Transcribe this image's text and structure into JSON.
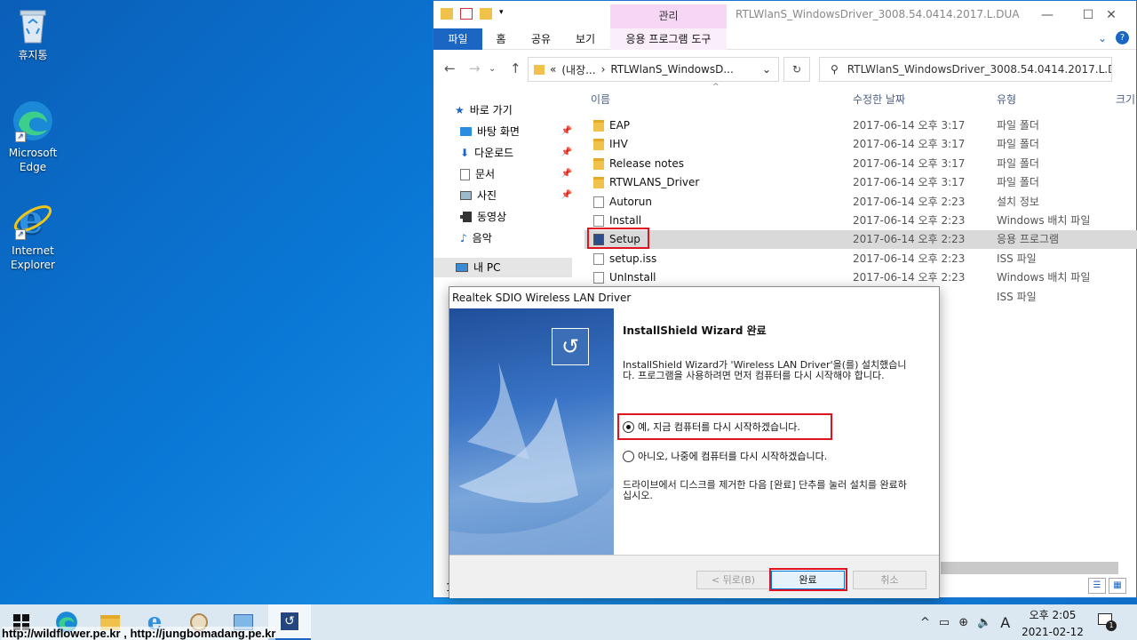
{
  "desktop": {
    "icons": [
      {
        "label": "휴지통"
      },
      {
        "label": "Microsoft Edge"
      },
      {
        "label": "Internet Explorer"
      }
    ]
  },
  "explorer": {
    "title": "RTLWlanS_WindowsDriver_3008.54.0414.2017.L.DUA",
    "manage_tab": "관리",
    "ribbon_tabs": [
      "파일",
      "홈",
      "공유",
      "보기",
      "응용 프로그램 도구"
    ],
    "address": {
      "prefix": "«",
      "crumb1": "(내장...",
      "sep": "›",
      "crumb2": "RTLWlanS_WindowsD..."
    },
    "search_placeholder": "RTLWlanS_WindowsDriver_3008.54.0414.2017.L.DUA ...",
    "nav": {
      "quick_access": "바로 가기",
      "desktop": "바탕 화면",
      "downloads": "다운로드",
      "documents": "문서",
      "pictures": "사진",
      "videos": "동영상",
      "music": "음악",
      "this_pc": "내 PC"
    },
    "columns": {
      "name": "이름",
      "modified": "수정한 날짜",
      "type": "유형",
      "size": "크기"
    },
    "files": [
      {
        "name": "EAP",
        "date": "2017-06-14 오후 3:17",
        "type": "파일 폴더",
        "kind": "folder"
      },
      {
        "name": "IHV",
        "date": "2017-06-14 오후 3:17",
        "type": "파일 폴더",
        "kind": "folder"
      },
      {
        "name": "Release notes",
        "date": "2017-06-14 오후 3:17",
        "type": "파일 폴더",
        "kind": "folder"
      },
      {
        "name": "RTWLANS_Driver",
        "date": "2017-06-14 오후 3:17",
        "type": "파일 폴더",
        "kind": "folder"
      },
      {
        "name": "Autorun",
        "date": "2017-06-14 오후 2:23",
        "type": "설치 정보",
        "kind": "doc"
      },
      {
        "name": "Install",
        "date": "2017-06-14 오후 2:23",
        "type": "Windows 배치 파일",
        "kind": "doc"
      },
      {
        "name": "Setup",
        "date": "2017-06-14 오후 2:23",
        "type": "응용 프로그램",
        "kind": "app"
      },
      {
        "name": "setup.iss",
        "date": "2017-06-14 오후 2:23",
        "type": "ISS 파일",
        "kind": "doc"
      },
      {
        "name": "UnInstall",
        "date": "2017-06-14 오후 2:23",
        "type": "Windows 배치 파일",
        "kind": "doc"
      },
      {
        "name": "",
        "date": "2:23",
        "type": "ISS 파일",
        "kind": "hidden"
      }
    ],
    "status_count": "1"
  },
  "dialog": {
    "title": "Realtek SDIO Wireless LAN Driver",
    "heading": "InstallShield Wizard 완료",
    "body": "InstallShield Wizard가 'Wireless LAN Driver'을(를) 설치했습니다. 프로그램을 사용하려면 먼저 컴퓨터를 다시 시작해야 합니다.",
    "option_restart_now": "예, 지금 컴퓨터를 다시 시작하겠습니다.",
    "option_restart_later": "아니오, 나중에 컴퓨터를 다시 시작하겠습니다.",
    "note": "드라이브에서 디스크를 제거한 다음 [완료] 단추를 눌러 설치를 완료하십시오.",
    "back_button": "< 뒤로(B)",
    "finish_button": "완료",
    "cancel_button": "취소"
  },
  "taskbar": {
    "time": "오후 2:05",
    "date": "2021-02-12",
    "ime": "A",
    "notification_count": "1"
  },
  "watermark": "http://wildflower.pe.kr , http://jungbomadang.pe.kr",
  "colors": {
    "accent": "#1a66c2",
    "highlight": "#e0141e",
    "manage_tab": "#f5d6f5"
  }
}
